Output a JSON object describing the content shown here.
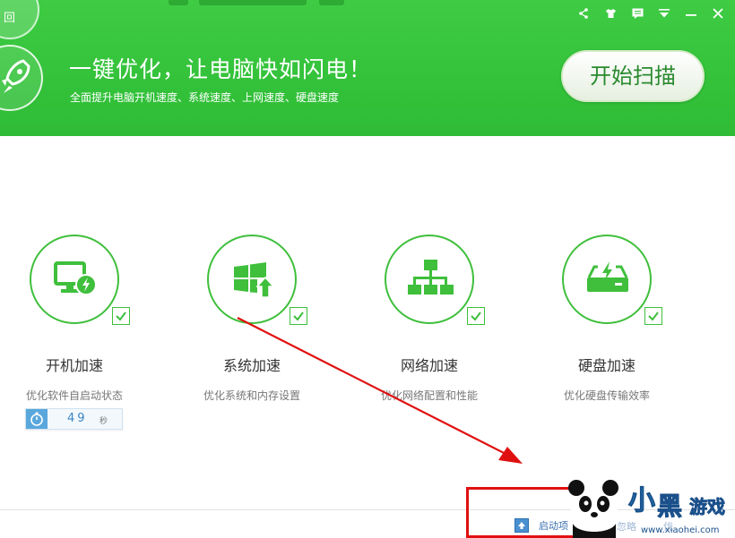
{
  "header": {
    "back_label": "回",
    "headline": "一键优化，让电脑快如闪电！",
    "subline": "全面提升电脑开机速度、系统速度、上网速度、硬盘速度",
    "scan_button": "开始扫描"
  },
  "features": [
    {
      "title": "开机加速",
      "desc": "优化软件自启动状态"
    },
    {
      "title": "系统加速",
      "desc": "优化系统和内存设置"
    },
    {
      "title": "网络加速",
      "desc": "优化网络配置和性能"
    },
    {
      "title": "硬盘加速",
      "desc": "优化硬盘传输效率"
    }
  ],
  "timer": {
    "value": "49",
    "unit": "秒"
  },
  "bottom": {
    "startup_label": "启动项",
    "link2": "忽略",
    "link3": "优"
  },
  "watermark": {
    "text": "小黑游戏",
    "url": "www.xiaohei.com"
  },
  "colors": {
    "brand_green": "#3fcc44",
    "accent_green": "#3fbf3c",
    "annotation_red": "#e01010"
  },
  "icons": [
    "share-icon",
    "skin-icon",
    "message-icon",
    "menu-icon",
    "minimize-icon",
    "close-icon",
    "rocket-icon",
    "monitor-lightning-icon",
    "windows-upload-icon",
    "network-icon",
    "harddisk-lightning-icon",
    "check-icon",
    "stopwatch-icon",
    "startup-icon"
  ]
}
